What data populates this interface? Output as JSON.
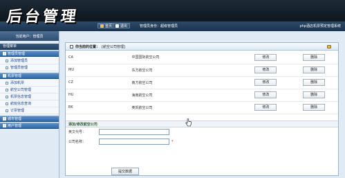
{
  "header": {
    "logo": "后台管理",
    "nav": [
      {
        "label": "首页"
      },
      {
        "label": "退出"
      }
    ],
    "user_info": "管理员身份：超级管理员",
    "system_title": "php酒店机票预定管理系统"
  },
  "sidebar": {
    "current_user": "当前用户：管理员",
    "main_menu": "管理菜单",
    "groups": [
      {
        "label": "管理员管理",
        "items": [
          "添加管理员",
          "管理员管理"
        ]
      },
      {
        "label": "机票管理",
        "items": [
          "添加机票",
          "航空公司管理",
          "机票信息管理",
          "航班信息查询",
          "订票管理"
        ]
      },
      {
        "label": "城市管理",
        "items": []
      },
      {
        "label": "用户管理",
        "items": []
      }
    ]
  },
  "panel": {
    "title_prefix": "你当前的位置：",
    "title_location": "[航空公司管理]",
    "rows": [
      {
        "code": "CA",
        "name": "中国国际航空公司",
        "edit": "修改",
        "delete": "删除"
      },
      {
        "code": "MU",
        "name": "东方航空公司",
        "edit": "修改",
        "delete": "删除"
      },
      {
        "code": "CZ",
        "name": "南方航空公司",
        "edit": "修改",
        "delete": "删除"
      },
      {
        "code": "HU",
        "name": "海南航空公司",
        "edit": "修改",
        "delete": "删除"
      },
      {
        "code": "BK",
        "name": "奥凯航空公司",
        "edit": "修改",
        "delete": "删除"
      }
    ],
    "form": {
      "title": "添加/修改航空公司",
      "code_label": "英文代号：",
      "code_value": "",
      "name_label": "公司名称：",
      "name_value": "",
      "required_mark": "*",
      "submit_label": "提交数据"
    }
  }
}
